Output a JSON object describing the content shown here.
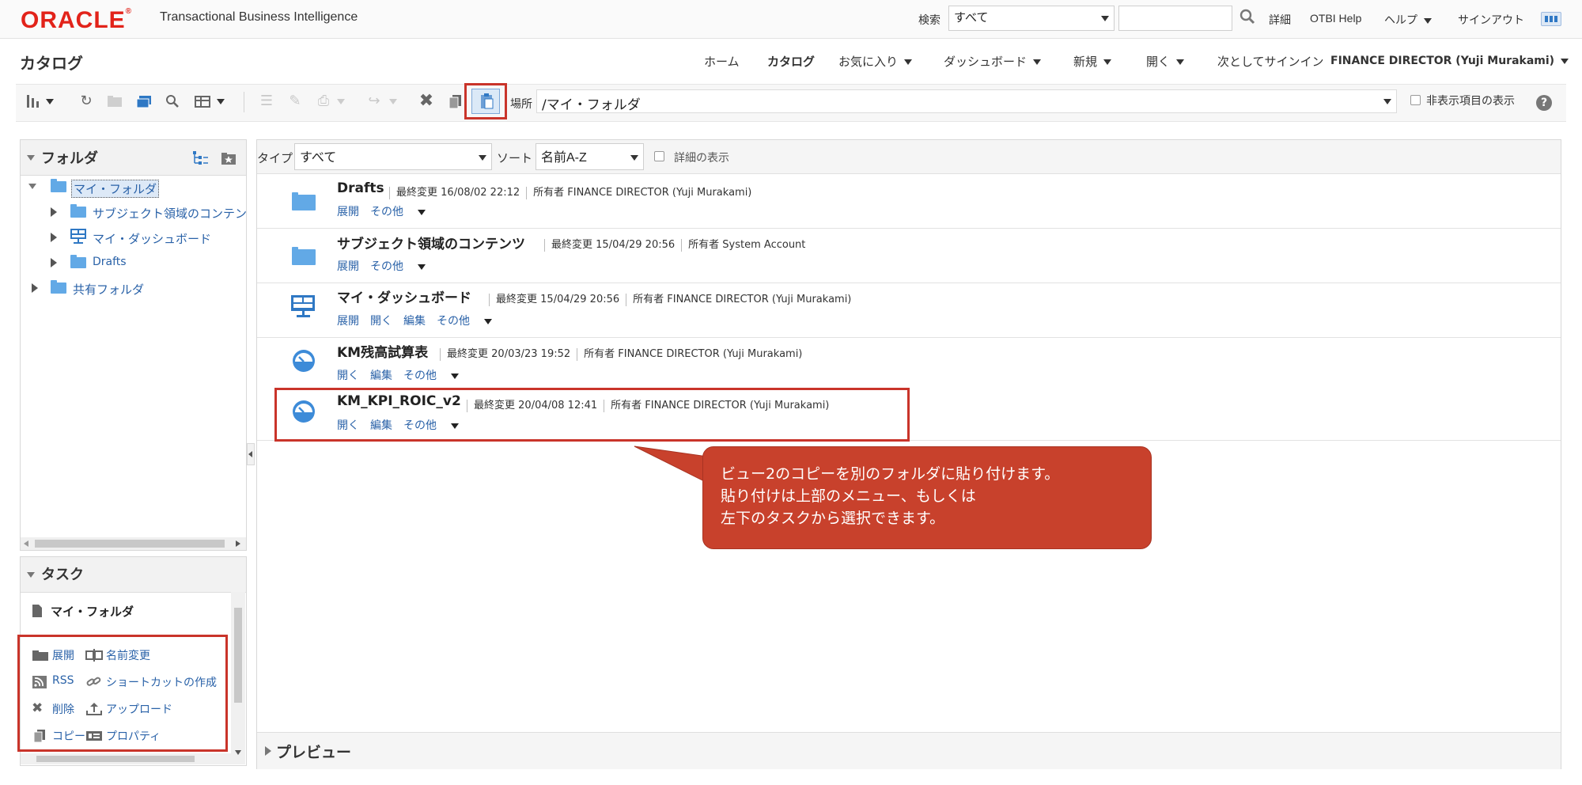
{
  "header": {
    "logo_text": "ORACLE",
    "product": "Transactional Business Intelligence",
    "search_label": "検索",
    "search_scope": "すべて",
    "search_placeholder": "",
    "links": [
      "詳細",
      "OTBI Help",
      "ヘルプ",
      "サインアウト"
    ]
  },
  "nav": {
    "page_title": "カタログ",
    "items": [
      "ホーム",
      "カタログ",
      "お気に入り",
      "ダッシュボード",
      "新規",
      "開く"
    ],
    "signin_label": "次としてサインイン",
    "user": "FINANCE DIRECTOR (Yuji Murakami)"
  },
  "toolbar": {
    "location_label": "場所",
    "location_value": "/マイ・フォルダ",
    "show_hidden_label": "非表示項目の表示"
  },
  "folders": {
    "title": "フォルダ",
    "tree": [
      {
        "label": "マイ・フォルダ",
        "level": 0
      },
      {
        "label": "サブジェクト領域のコンテンツ",
        "level": 1
      },
      {
        "label": "マイ・ダッシュボード",
        "level": 1
      },
      {
        "label": "Drafts",
        "level": 1
      },
      {
        "label": "共有フォルダ",
        "level": 0
      }
    ]
  },
  "tasks": {
    "title": "タスク",
    "context": "マイ・フォルダ",
    "items": [
      {
        "label": "展開",
        "icon": "folder-icon"
      },
      {
        "label": "名前変更",
        "icon": "rename-icon"
      },
      {
        "label": "RSS",
        "icon": "rss-icon"
      },
      {
        "label": "ショートカットの作成",
        "icon": "link-icon"
      },
      {
        "label": "削除",
        "icon": "delete-icon"
      },
      {
        "label": "アップロード",
        "icon": "upload-icon"
      },
      {
        "label": "コピー",
        "icon": "copy-icon"
      },
      {
        "label": "プロパティ",
        "icon": "properties-icon"
      }
    ]
  },
  "filter": {
    "type_label": "タイプ",
    "type_value": "すべて",
    "sort_label": "ソート",
    "sort_value": "名前A-Z",
    "detail_label": "詳細の表示"
  },
  "items": [
    {
      "name": "Drafts",
      "modified_label": "最終変更",
      "modified": "16/08/02 22:12",
      "owner_label": "所有者",
      "owner": "FINANCE DIRECTOR (Yuji Murakami)",
      "links": [
        "展開",
        "その他"
      ],
      "icon": "folder-icon"
    },
    {
      "name": "サブジェクト領域のコンテンツ",
      "modified_label": "最終変更",
      "modified": "15/04/29 20:56",
      "owner_label": "所有者",
      "owner": "System Account",
      "links": [
        "展開",
        "その他"
      ],
      "icon": "folder-icon"
    },
    {
      "name": "マイ・ダッシュボード",
      "modified_label": "最終変更",
      "modified": "15/04/29 20:56",
      "owner_label": "所有者",
      "owner": "FINANCE DIRECTOR (Yuji Murakami)",
      "links": [
        "展開",
        "開く",
        "編集",
        "その他"
      ],
      "icon": "dashboard-icon"
    },
    {
      "name": "KM残高試算表",
      "modified_label": "最終変更",
      "modified": "20/03/23 19:52",
      "owner_label": "所有者",
      "owner": "FINANCE DIRECTOR (Yuji Murakami)",
      "links": [
        "開く",
        "編集",
        "その他"
      ],
      "icon": "analysis-icon"
    },
    {
      "name": "KM_KPI_ROIC_v2",
      "modified_label": "最終変更",
      "modified": "20/04/08 12:41",
      "owner_label": "所有者",
      "owner": "FINANCE DIRECTOR (Yuji Murakami)",
      "links": [
        "開く",
        "編集",
        "その他"
      ],
      "icon": "analysis-icon"
    }
  ],
  "callout": {
    "lines": [
      "ビュー2のコピーを別のフォルダに貼り付けます。",
      "貼り付けは上部のメニュー、もしくは",
      "左下のタスクから選択できます。"
    ]
  },
  "preview": {
    "label": "プレビュー"
  },
  "colors": {
    "accent": "#c9342a",
    "link": "#2a62a8",
    "folder": "#62a9e6"
  }
}
